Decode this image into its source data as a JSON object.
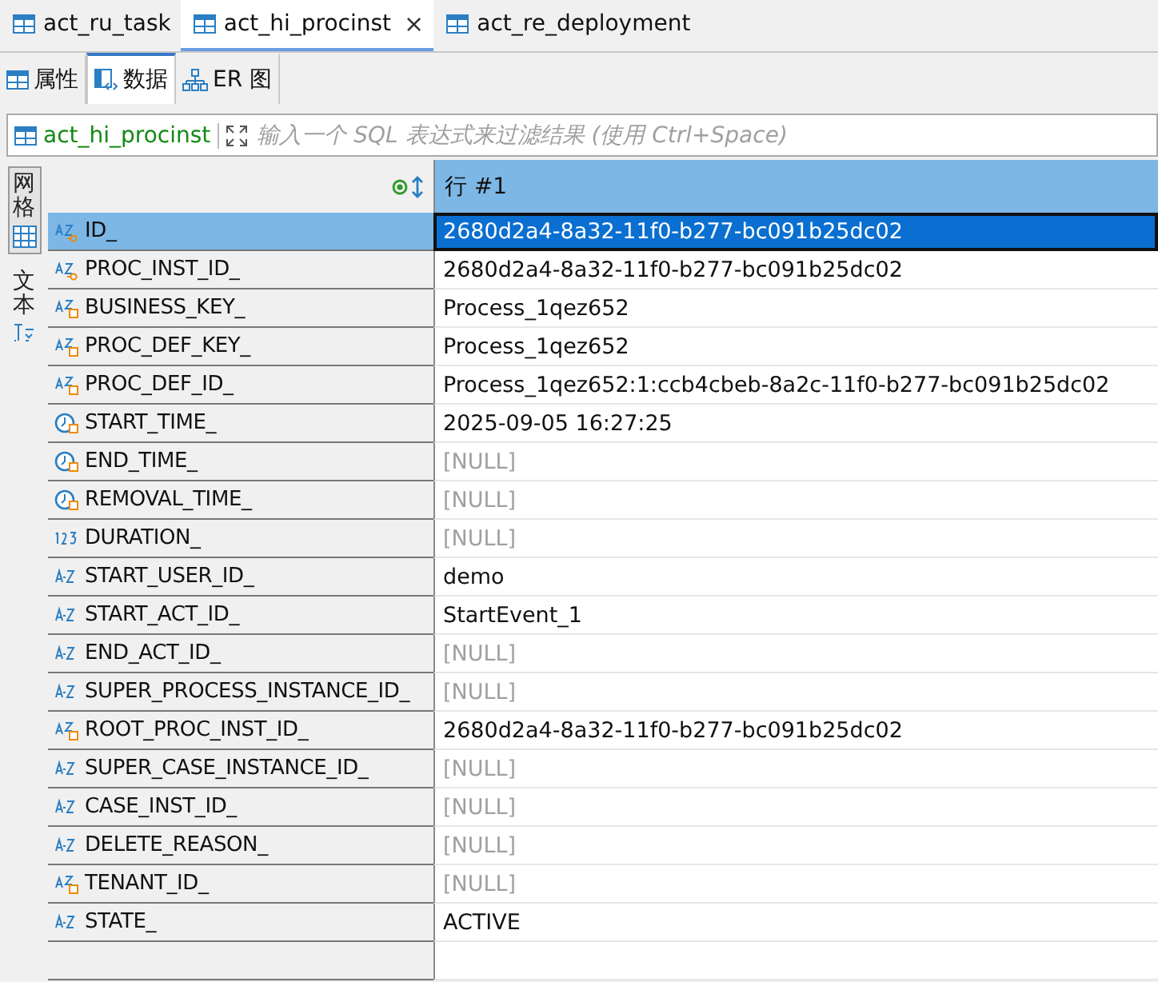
{
  "editor_tabs": [
    {
      "label": "act_ru_task",
      "selected": false
    },
    {
      "label": "act_hi_procinst",
      "selected": true,
      "close": "×"
    },
    {
      "label": "act_re_deployment",
      "selected": false
    }
  ],
  "sub_tabs": [
    {
      "label": "属性",
      "kind": "table",
      "selected": false
    },
    {
      "label": "数据",
      "kind": "data",
      "selected": true
    },
    {
      "label": "ER 图",
      "kind": "diagram",
      "selected": false
    }
  ],
  "filter": {
    "table": "act_hi_procinst",
    "placeholder": "输入一个 SQL 表达式来过滤结果 (使用 Ctrl+Space)"
  },
  "view_tabs": [
    {
      "label": "网格",
      "kind": "grid",
      "selected": true
    },
    {
      "label": "文本",
      "kind": "text",
      "selected": false
    }
  ],
  "grid": {
    "value_header": "行 #1",
    "rows": [
      {
        "name": "ID_",
        "kind": "key",
        "value": "2680d2a4-8a32-11f0-b277-bc091b25dc02",
        "is_null": false,
        "selected": true
      },
      {
        "name": "PROC_INST_ID_",
        "kind": "key",
        "value": "2680d2a4-8a32-11f0-b277-bc091b25dc02",
        "is_null": false,
        "selected": false
      },
      {
        "name": "BUSINESS_KEY_",
        "kind": "indexed",
        "value": "Process_1qez652",
        "is_null": false,
        "selected": false
      },
      {
        "name": "PROC_DEF_KEY_",
        "kind": "indexed",
        "value": "Process_1qez652",
        "is_null": false,
        "selected": false
      },
      {
        "name": "PROC_DEF_ID_",
        "kind": "indexed",
        "value": "Process_1qez652:1:ccb4cbeb-8a2c-11f0-b277-bc091b25dc02",
        "is_null": false,
        "selected": false
      },
      {
        "name": "START_TIME_",
        "kind": "datetime",
        "value": "2025-09-05 16:27:25",
        "is_null": false,
        "selected": false
      },
      {
        "name": "END_TIME_",
        "kind": "datetime",
        "value": "[NULL]",
        "is_null": true,
        "selected": false
      },
      {
        "name": "REMOVAL_TIME_",
        "kind": "datetime",
        "value": "[NULL]",
        "is_null": true,
        "selected": false
      },
      {
        "name": "DURATION_",
        "kind": "number",
        "value": "[NULL]",
        "is_null": true,
        "selected": false
      },
      {
        "name": "START_USER_ID_",
        "kind": "text",
        "value": "demo",
        "is_null": false,
        "selected": false
      },
      {
        "name": "START_ACT_ID_",
        "kind": "text",
        "value": "StartEvent_1",
        "is_null": false,
        "selected": false
      },
      {
        "name": "END_ACT_ID_",
        "kind": "text",
        "value": "[NULL]",
        "is_null": true,
        "selected": false
      },
      {
        "name": "SUPER_PROCESS_INSTANCE_ID_",
        "kind": "text",
        "value": "[NULL]",
        "is_null": true,
        "selected": false
      },
      {
        "name": "ROOT_PROC_INST_ID_",
        "kind": "indexed",
        "value": "2680d2a4-8a32-11f0-b277-bc091b25dc02",
        "is_null": false,
        "selected": false
      },
      {
        "name": "SUPER_CASE_INSTANCE_ID_",
        "kind": "text",
        "value": "[NULL]",
        "is_null": true,
        "selected": false
      },
      {
        "name": "CASE_INST_ID_",
        "kind": "text",
        "value": "[NULL]",
        "is_null": true,
        "selected": false
      },
      {
        "name": "DELETE_REASON_",
        "kind": "text",
        "value": "[NULL]",
        "is_null": true,
        "selected": false
      },
      {
        "name": "TENANT_ID_",
        "kind": "indexed",
        "value": "[NULL]",
        "is_null": true,
        "selected": false
      },
      {
        "name": "STATE_",
        "kind": "text",
        "value": "ACTIVE",
        "is_null": false,
        "selected": false
      }
    ]
  }
}
